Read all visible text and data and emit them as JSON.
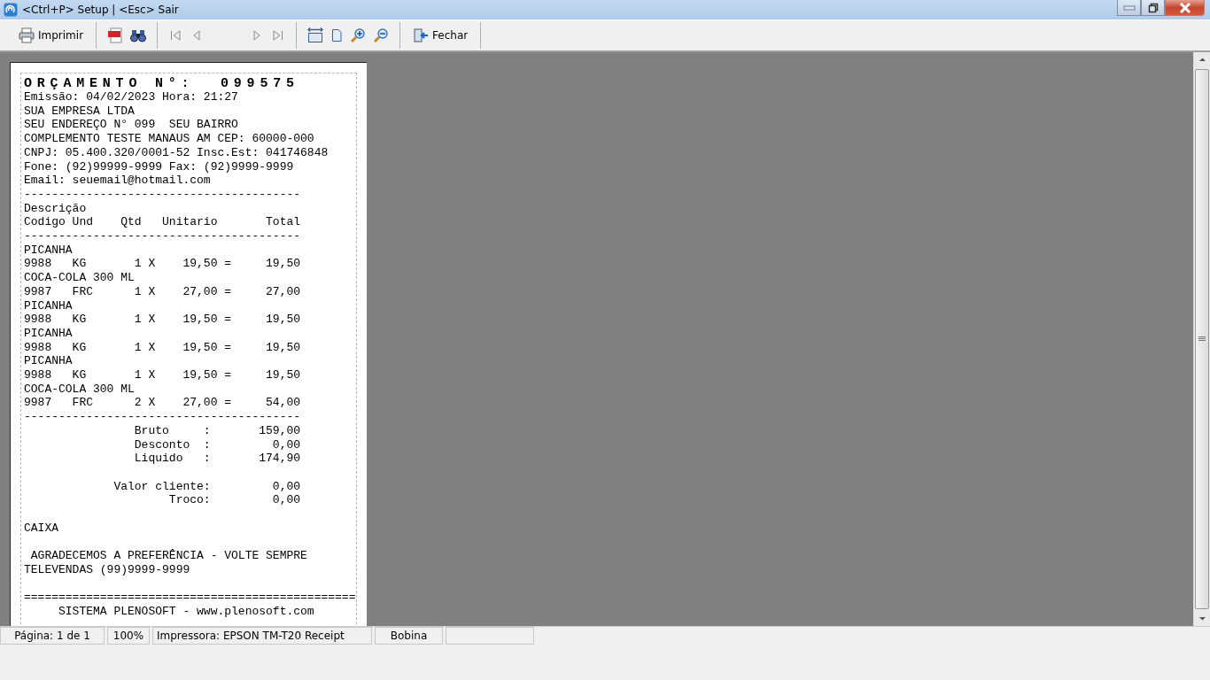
{
  "window": {
    "title": "<Ctrl+P> Setup | <Esc> Sair"
  },
  "toolbar": [
    [
      {
        "kind": "print",
        "label": "Imprimir"
      }
    ],
    [
      {
        "kind": "pdf"
      },
      {
        "kind": "find"
      }
    ],
    [
      {
        "kind": "first"
      },
      {
        "kind": "prev"
      },
      {
        "kind": "gap"
      },
      {
        "kind": "next"
      },
      {
        "kind": "last"
      }
    ],
    [
      {
        "kind": "page_width"
      },
      {
        "kind": "whole_page"
      },
      {
        "kind": "zoom_in"
      },
      {
        "kind": "zoom_out"
      }
    ],
    [
      {
        "kind": "close",
        "label": "Fechar"
      }
    ]
  ],
  "receipt": [
    {
      "kind": "title",
      "text": "ORÇAMENTO N°:  099575"
    },
    {
      "kind": "line",
      "text": "Emissão: 04/02/2023 Hora: 21:27"
    },
    {
      "kind": "line",
      "text": "SUA EMPRESA LTDA"
    },
    {
      "kind": "line",
      "text": "SEU ENDEREÇO N° 099  SEU BAIRRO"
    },
    {
      "kind": "line",
      "text": "COMPLEMENTO TESTE MANAUS AM CEP: 60000-000"
    },
    {
      "kind": "line",
      "text": "CNPJ: 05.400.320/0001-52 Insc.Est: 041746848"
    },
    {
      "kind": "line",
      "text": "Fone: (92)99999-9999 Fax: (92)9999-9999"
    },
    {
      "kind": "line",
      "text": "Email: seuemail@hotmail.com"
    },
    {
      "kind": "rule",
      "text": "----------------------------------------"
    },
    {
      "kind": "line",
      "text": "Descrição"
    },
    {
      "kind": "line",
      "text": "Codigo Und    Qtd   Unitario       Total"
    },
    {
      "kind": "rule",
      "text": "----------------------------------------"
    },
    {
      "kind": "line",
      "text": "PICANHA"
    },
    {
      "kind": "line",
      "text": "9988   KG       1 X    19,50 =     19,50"
    },
    {
      "kind": "line",
      "text": "COCA-COLA 300 ML"
    },
    {
      "kind": "line",
      "text": "9987   FRC      1 X    27,00 =     27,00"
    },
    {
      "kind": "line",
      "text": "PICANHA"
    },
    {
      "kind": "line",
      "text": "9988   KG       1 X    19,50 =     19,50"
    },
    {
      "kind": "line",
      "text": "PICANHA"
    },
    {
      "kind": "line",
      "text": "9988   KG       1 X    19,50 =     19,50"
    },
    {
      "kind": "line",
      "text": "PICANHA"
    },
    {
      "kind": "line",
      "text": "9988   KG       1 X    19,50 =     19,50"
    },
    {
      "kind": "line",
      "text": "COCA-COLA 300 ML"
    },
    {
      "kind": "line",
      "text": "9987   FRC      2 X    27,00 =     54,00"
    },
    {
      "kind": "rule",
      "text": "----------------------------------------"
    },
    {
      "kind": "line",
      "text": "                Bruto     :       159,00"
    },
    {
      "kind": "line",
      "text": "                Desconto  :         0,00"
    },
    {
      "kind": "line",
      "text": "                Liquido   :       174,90"
    },
    {
      "kind": "blank"
    },
    {
      "kind": "line",
      "text": "             Valor cliente:         0,00"
    },
    {
      "kind": "line",
      "text": "                     Troco:         0,00"
    },
    {
      "kind": "blank"
    },
    {
      "kind": "line",
      "text": "CAIXA"
    },
    {
      "kind": "blank"
    },
    {
      "kind": "line",
      "text": " AGRADECEMOS A PREFERÊNCIA - VOLTE SEMPRE"
    },
    {
      "kind": "line",
      "text": "TELEVENDAS (99)9999-9999"
    },
    {
      "kind": "blank"
    },
    {
      "kind": "rule",
      "text": "================================================"
    },
    {
      "kind": "line",
      "text": "     SISTEMA PLENOSOFT - www.plenosoft.com"
    }
  ],
  "status_bar": [
    "Página: 1 de 1",
    "100%",
    "Impressora: EPSON TM-T20 Receipt",
    "Bobina"
  ]
}
